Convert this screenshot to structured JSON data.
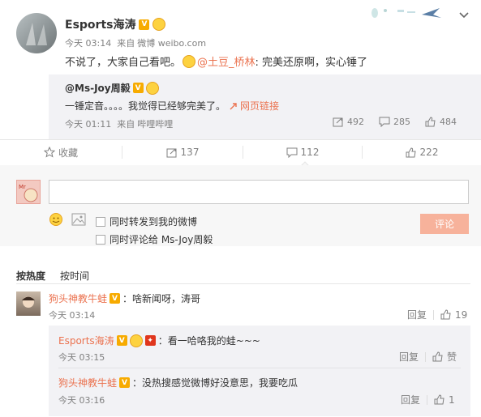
{
  "post": {
    "author": "Esports海涛",
    "time": "今天 03:14",
    "from_label": "来自",
    "source": "微博 weibo.com",
    "text_before": "不说了，大家自己看吧。",
    "mention": "@土豆_桥林",
    "text_after": ":  完美还原啊，实心锤了"
  },
  "repost": {
    "author": "@Ms-Joy周毅",
    "text": "一锤定音。。。。我觉得已经够完美了。",
    "link_label": "网页链接",
    "time": "今天 01:11",
    "from_label": "来自",
    "source": "哔哩哔哩",
    "reposts": "492",
    "comments": "285",
    "likes": "484"
  },
  "actions": {
    "favorite": "收藏",
    "repost": "137",
    "comment": "112",
    "like": "222"
  },
  "composer": {
    "placeholder": "",
    "option1": "同时转发到我的微博",
    "option2": "同时评论给 Ms-Joy周毅",
    "submit": "评论"
  },
  "sort": {
    "hot": "按热度",
    "time": "按时间"
  },
  "comments": [
    {
      "author": "狗头神教牛蛙",
      "text": "：啥新闻呀，涛哥",
      "time": "今天 03:14",
      "reply": "回复",
      "likes": "19",
      "replies": [
        {
          "author": "Esports海涛",
          "text": "：看一哈咯我的蛙~~~",
          "time": "今天 03:15",
          "reply": "回复",
          "likes": "赞"
        },
        {
          "author": "狗头神教牛蛙",
          "text": "：没热搜感觉微博好没意思，我要吃瓜",
          "time": "今天 03:16",
          "reply": "回复",
          "likes": "1"
        }
      ]
    }
  ],
  "colors": {
    "accent": "#eb7350",
    "submit_disabled": "#f7b29b",
    "divider": "#f2f2f5",
    "subpanel": "#f2f2f5"
  }
}
